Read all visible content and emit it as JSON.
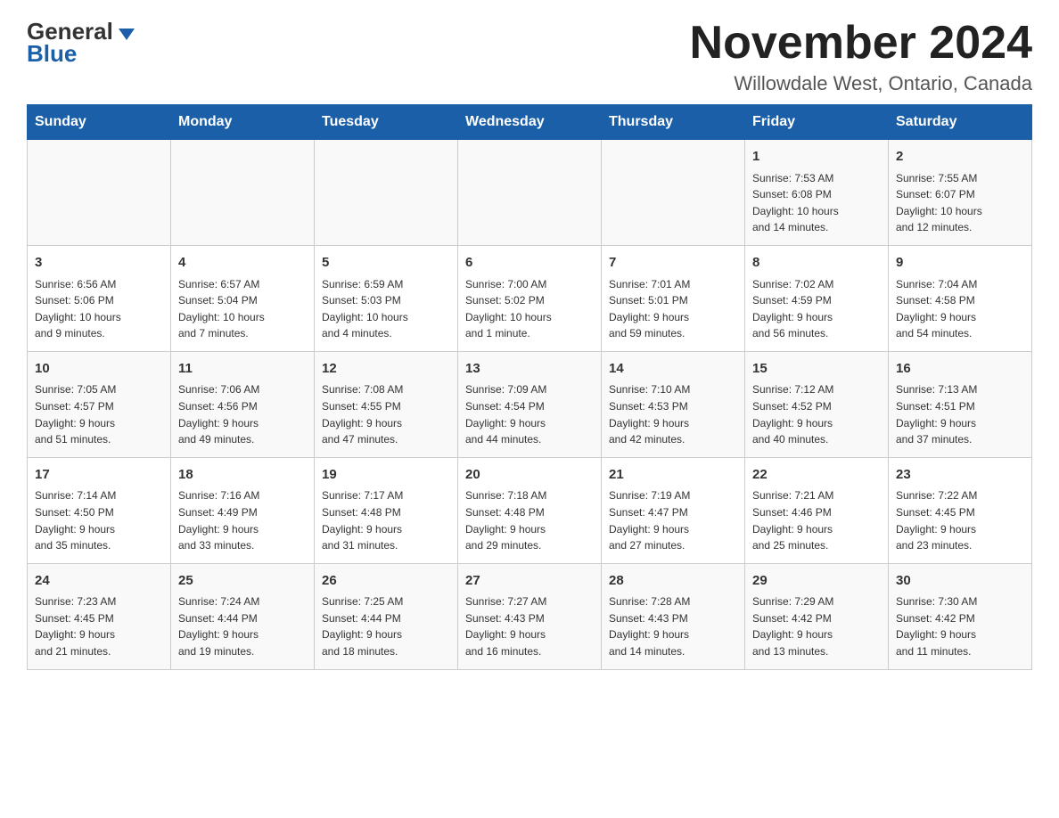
{
  "header": {
    "logo_general": "General",
    "logo_blue": "Blue",
    "month_title": "November 2024",
    "location": "Willowdale West, Ontario, Canada"
  },
  "days_of_week": [
    "Sunday",
    "Monday",
    "Tuesday",
    "Wednesday",
    "Thursday",
    "Friday",
    "Saturday"
  ],
  "weeks": [
    [
      {
        "day": "",
        "info": ""
      },
      {
        "day": "",
        "info": ""
      },
      {
        "day": "",
        "info": ""
      },
      {
        "day": "",
        "info": ""
      },
      {
        "day": "",
        "info": ""
      },
      {
        "day": "1",
        "info": "Sunrise: 7:53 AM\nSunset: 6:08 PM\nDaylight: 10 hours\nand 14 minutes."
      },
      {
        "day": "2",
        "info": "Sunrise: 7:55 AM\nSunset: 6:07 PM\nDaylight: 10 hours\nand 12 minutes."
      }
    ],
    [
      {
        "day": "3",
        "info": "Sunrise: 6:56 AM\nSunset: 5:06 PM\nDaylight: 10 hours\nand 9 minutes."
      },
      {
        "day": "4",
        "info": "Sunrise: 6:57 AM\nSunset: 5:04 PM\nDaylight: 10 hours\nand 7 minutes."
      },
      {
        "day": "5",
        "info": "Sunrise: 6:59 AM\nSunset: 5:03 PM\nDaylight: 10 hours\nand 4 minutes."
      },
      {
        "day": "6",
        "info": "Sunrise: 7:00 AM\nSunset: 5:02 PM\nDaylight: 10 hours\nand 1 minute."
      },
      {
        "day": "7",
        "info": "Sunrise: 7:01 AM\nSunset: 5:01 PM\nDaylight: 9 hours\nand 59 minutes."
      },
      {
        "day": "8",
        "info": "Sunrise: 7:02 AM\nSunset: 4:59 PM\nDaylight: 9 hours\nand 56 minutes."
      },
      {
        "day": "9",
        "info": "Sunrise: 7:04 AM\nSunset: 4:58 PM\nDaylight: 9 hours\nand 54 minutes."
      }
    ],
    [
      {
        "day": "10",
        "info": "Sunrise: 7:05 AM\nSunset: 4:57 PM\nDaylight: 9 hours\nand 51 minutes."
      },
      {
        "day": "11",
        "info": "Sunrise: 7:06 AM\nSunset: 4:56 PM\nDaylight: 9 hours\nand 49 minutes."
      },
      {
        "day": "12",
        "info": "Sunrise: 7:08 AM\nSunset: 4:55 PM\nDaylight: 9 hours\nand 47 minutes."
      },
      {
        "day": "13",
        "info": "Sunrise: 7:09 AM\nSunset: 4:54 PM\nDaylight: 9 hours\nand 44 minutes."
      },
      {
        "day": "14",
        "info": "Sunrise: 7:10 AM\nSunset: 4:53 PM\nDaylight: 9 hours\nand 42 minutes."
      },
      {
        "day": "15",
        "info": "Sunrise: 7:12 AM\nSunset: 4:52 PM\nDaylight: 9 hours\nand 40 minutes."
      },
      {
        "day": "16",
        "info": "Sunrise: 7:13 AM\nSunset: 4:51 PM\nDaylight: 9 hours\nand 37 minutes."
      }
    ],
    [
      {
        "day": "17",
        "info": "Sunrise: 7:14 AM\nSunset: 4:50 PM\nDaylight: 9 hours\nand 35 minutes."
      },
      {
        "day": "18",
        "info": "Sunrise: 7:16 AM\nSunset: 4:49 PM\nDaylight: 9 hours\nand 33 minutes."
      },
      {
        "day": "19",
        "info": "Sunrise: 7:17 AM\nSunset: 4:48 PM\nDaylight: 9 hours\nand 31 minutes."
      },
      {
        "day": "20",
        "info": "Sunrise: 7:18 AM\nSunset: 4:48 PM\nDaylight: 9 hours\nand 29 minutes."
      },
      {
        "day": "21",
        "info": "Sunrise: 7:19 AM\nSunset: 4:47 PM\nDaylight: 9 hours\nand 27 minutes."
      },
      {
        "day": "22",
        "info": "Sunrise: 7:21 AM\nSunset: 4:46 PM\nDaylight: 9 hours\nand 25 minutes."
      },
      {
        "day": "23",
        "info": "Sunrise: 7:22 AM\nSunset: 4:45 PM\nDaylight: 9 hours\nand 23 minutes."
      }
    ],
    [
      {
        "day": "24",
        "info": "Sunrise: 7:23 AM\nSunset: 4:45 PM\nDaylight: 9 hours\nand 21 minutes."
      },
      {
        "day": "25",
        "info": "Sunrise: 7:24 AM\nSunset: 4:44 PM\nDaylight: 9 hours\nand 19 minutes."
      },
      {
        "day": "26",
        "info": "Sunrise: 7:25 AM\nSunset: 4:44 PM\nDaylight: 9 hours\nand 18 minutes."
      },
      {
        "day": "27",
        "info": "Sunrise: 7:27 AM\nSunset: 4:43 PM\nDaylight: 9 hours\nand 16 minutes."
      },
      {
        "day": "28",
        "info": "Sunrise: 7:28 AM\nSunset: 4:43 PM\nDaylight: 9 hours\nand 14 minutes."
      },
      {
        "day": "29",
        "info": "Sunrise: 7:29 AM\nSunset: 4:42 PM\nDaylight: 9 hours\nand 13 minutes."
      },
      {
        "day": "30",
        "info": "Sunrise: 7:30 AM\nSunset: 4:42 PM\nDaylight: 9 hours\nand 11 minutes."
      }
    ]
  ]
}
